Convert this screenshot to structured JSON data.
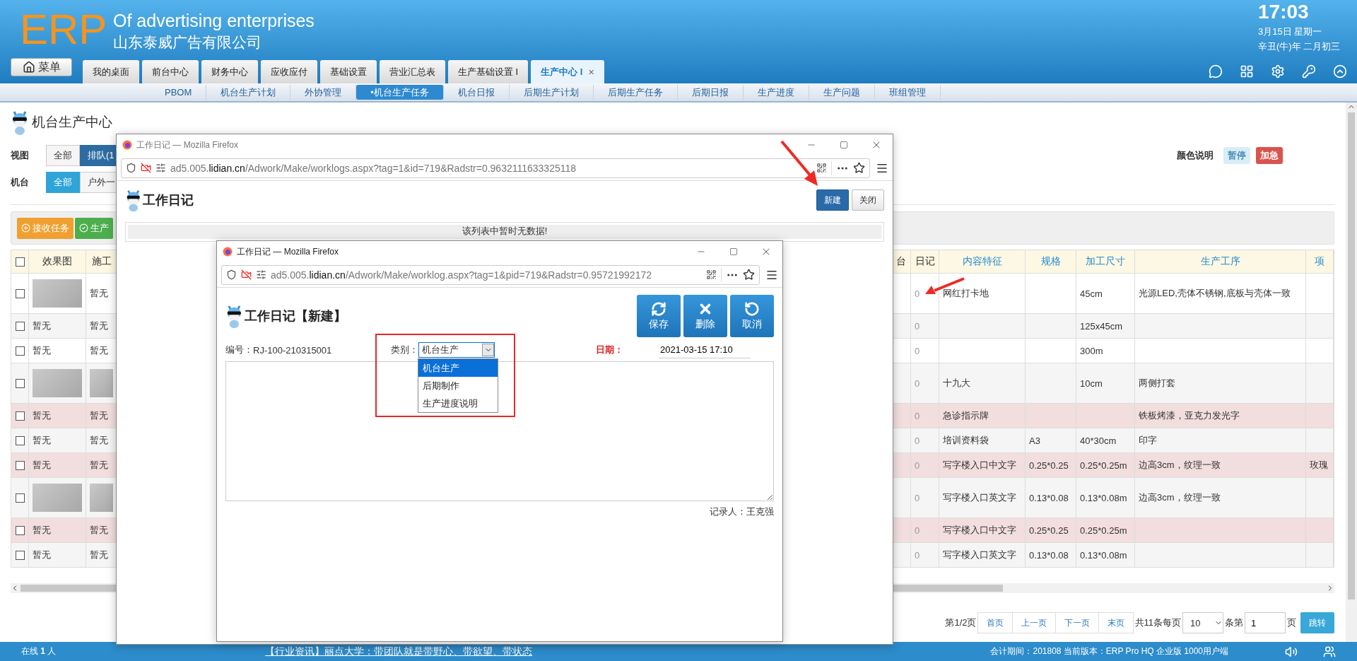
{
  "header": {
    "logo": "ERP",
    "title": "Of advertising enterprises",
    "company": "山东泰威广告有限公司",
    "time": "17:03",
    "date": "3月15日 星期一",
    "lunar": "辛丑(牛)年 二月初三",
    "menu_button": "菜单"
  },
  "tabs": [
    {
      "label": "我的桌面",
      "selected": false,
      "closable": false
    },
    {
      "label": "前台中心",
      "selected": false,
      "closable": false
    },
    {
      "label": "财务中心",
      "selected": false,
      "closable": false
    },
    {
      "label": "应收应付",
      "selected": false,
      "closable": false
    },
    {
      "label": "基础设置",
      "selected": false,
      "closable": false
    },
    {
      "label": "营业汇总表",
      "selected": false,
      "closable": false
    },
    {
      "label": "生产基础设置 I",
      "selected": false,
      "closable": false
    },
    {
      "label": "生产中心 I",
      "selected": true,
      "closable": true
    }
  ],
  "close_glyph": "×",
  "subnav": [
    {
      "label": "PBOM",
      "selected": false
    },
    {
      "label": "机台生产计划",
      "selected": false
    },
    {
      "label": "外协管理",
      "selected": false
    },
    {
      "label": "•机台生产任务",
      "selected": true
    },
    {
      "label": "机台日报",
      "selected": false
    },
    {
      "label": "后期生产计划",
      "selected": false
    },
    {
      "label": "后期生产任务",
      "selected": false
    },
    {
      "label": "后期日报",
      "selected": false
    },
    {
      "label": "生产进度",
      "selected": false
    },
    {
      "label": "生产问题",
      "selected": false
    },
    {
      "label": "班组管理",
      "selected": false
    }
  ],
  "page_title": "机台生产中心",
  "filters": [
    {
      "label": "视图",
      "kind": "primary",
      "options": [
        {
          "label": "全部",
          "selected": false
        },
        {
          "label": "排队(1",
          "selected": true
        }
      ]
    },
    {
      "label": "机台",
      "kind": "info",
      "options": [
        {
          "label": "全部",
          "selected": true
        },
        {
          "label": "户外一",
          "selected": false
        }
      ]
    }
  ],
  "color_legend": {
    "label": "颜色说明",
    "items": [
      {
        "label": "暂停",
        "color": "#d9edf7"
      },
      {
        "label": "加急",
        "color": "#d9534f"
      }
    ]
  },
  "actions": [
    {
      "label": "接收任务",
      "kind": "warning"
    },
    {
      "label": "生产",
      "kind": "success"
    }
  ],
  "table": {
    "all_checked": false,
    "columns": [
      {
        "label": "效果图",
        "sortable": false
      },
      {
        "label": "施工",
        "sortable": false
      },
      {
        "label": "台",
        "sortable": false
      },
      {
        "label": "日记",
        "sortable": false
      },
      {
        "label": "内容特征",
        "sortable": true
      },
      {
        "label": "规格",
        "sortable": true
      },
      {
        "label": "加工尺寸",
        "sortable": true
      },
      {
        "label": "生产工序",
        "sortable": true
      },
      {
        "label": "项",
        "sortable": true
      }
    ],
    "rows": [
      {
        "checked": false,
        "urgent": false,
        "cells": [
          {
            "kind": "image"
          },
          {
            "kind": "text",
            "text": "暂无"
          },
          null,
          {
            "kind": "count",
            "text": "0"
          },
          {
            "kind": "text",
            "text": "网红打卡地"
          },
          null,
          {
            "kind": "text",
            "text": "45cm"
          },
          {
            "kind": "text",
            "text": "光源LED,壳体不锈钢,底板与壳体一致"
          },
          null
        ]
      },
      {
        "checked": false,
        "urgent": false,
        "cells": [
          {
            "kind": "text",
            "text": "暂无"
          },
          {
            "kind": "text",
            "text": "暂无"
          },
          null,
          {
            "kind": "count",
            "text": "0"
          },
          null,
          null,
          {
            "kind": "text",
            "text": "125x45cm"
          },
          null,
          null
        ]
      },
      {
        "checked": false,
        "urgent": false,
        "cells": [
          {
            "kind": "text",
            "text": "暂无"
          },
          {
            "kind": "text",
            "text": "暂无"
          },
          null,
          {
            "kind": "count",
            "text": "0"
          },
          null,
          null,
          {
            "kind": "text",
            "text": "300m"
          },
          null,
          null
        ]
      },
      {
        "checked": false,
        "urgent": false,
        "cells": [
          {
            "kind": "image"
          },
          {
            "kind": "image"
          },
          null,
          {
            "kind": "count",
            "text": "0"
          },
          {
            "kind": "text",
            "text": "十九大"
          },
          null,
          {
            "kind": "text",
            "text": "10cm"
          },
          {
            "kind": "text",
            "text": "两侧打套"
          },
          null
        ]
      },
      {
        "checked": false,
        "urgent": true,
        "cells": [
          {
            "kind": "text",
            "text": "暂无"
          },
          {
            "kind": "text",
            "text": "暂无"
          },
          null,
          {
            "kind": "count",
            "text": "0"
          },
          {
            "kind": "text",
            "text": "急诊指示牌"
          },
          null,
          null,
          {
            "kind": "text",
            "text": "铁板烤漆，亚克力发光字"
          },
          null
        ]
      },
      {
        "checked": false,
        "urgent": false,
        "cells": [
          {
            "kind": "text",
            "text": "暂无"
          },
          {
            "kind": "text",
            "text": "暂无"
          },
          null,
          {
            "kind": "count",
            "text": "0"
          },
          {
            "kind": "text",
            "text": "培训资料袋"
          },
          {
            "kind": "text",
            "text": "A3"
          },
          {
            "kind": "text",
            "text": "40*30cm"
          },
          {
            "kind": "text",
            "text": "印字"
          },
          null
        ]
      },
      {
        "checked": false,
        "urgent": true,
        "cells": [
          {
            "kind": "text",
            "text": "暂无"
          },
          {
            "kind": "text",
            "text": "暂无"
          },
          null,
          {
            "kind": "count",
            "text": "0"
          },
          {
            "kind": "text",
            "text": "写字楼入口中文字"
          },
          {
            "kind": "text",
            "text": "0.25*0.25"
          },
          {
            "kind": "text",
            "text": "0.25*0.25m"
          },
          {
            "kind": "text",
            "text": "边高3cm，纹理一致"
          },
          {
            "kind": "text",
            "text": "玫瑰"
          }
        ]
      },
      {
        "checked": false,
        "urgent": false,
        "cells": [
          {
            "kind": "image"
          },
          {
            "kind": "image"
          },
          null,
          {
            "kind": "count",
            "text": "0"
          },
          {
            "kind": "text",
            "text": "写字楼入口英文字"
          },
          {
            "kind": "text",
            "text": "0.13*0.08"
          },
          {
            "kind": "text",
            "text": "0.13*0.08m"
          },
          {
            "kind": "text",
            "text": "边高3cm，纹理一致"
          },
          null
        ]
      },
      {
        "checked": false,
        "urgent": true,
        "cells": [
          {
            "kind": "text",
            "text": "暂无"
          },
          {
            "kind": "text",
            "text": "暂无"
          },
          null,
          {
            "kind": "count",
            "text": "0"
          },
          {
            "kind": "text",
            "text": "写字楼入口中文字"
          },
          {
            "kind": "text",
            "text": "0.25*0.25"
          },
          {
            "kind": "text",
            "text": "0.25*0.25m"
          },
          null,
          null
        ]
      },
      {
        "checked": false,
        "urgent": false,
        "cells": [
          {
            "kind": "text",
            "text": "暂无"
          },
          {
            "kind": "text",
            "text": "暂无"
          },
          null,
          {
            "kind": "count",
            "text": "0"
          },
          {
            "kind": "text",
            "text": "写字楼入口英文字"
          },
          {
            "kind": "text",
            "text": "0.13*0.08"
          },
          {
            "kind": "text",
            "text": "0.13*0.08m"
          },
          null,
          null
        ]
      }
    ]
  },
  "pagination": {
    "page_info": "第1/2页",
    "nav": [
      "首页",
      "上一页",
      "下一页",
      "末页"
    ],
    "total_text": "共11条每页",
    "page_size": "10",
    "goto_prefix": "条第",
    "page": "1",
    "goto_suffix": "页",
    "goto_button": "跳转"
  },
  "status_bar": {
    "online": "在线 **1** 人",
    "news": "【行业资讯】丽点大学：带团队就是带野心、带欲望、带状态",
    "info": "会计期间：201808 当前版本：ERP Pro HQ 企业版 1000用户端"
  },
  "outer_window": {
    "title": "工作日记 — Mozilla Firefox",
    "url": {
      "host_prefix": "ad5.005.",
      "domain": "lidian.cn",
      "path": "/Adwork/Make/worklogs.aspx?tag=1&id=719&Radstr=0.9632111633325118"
    },
    "heading": "工作日记",
    "buttons": [
      {
        "label": "新建",
        "kind": "primary"
      },
      {
        "label": "关闭",
        "kind": "default"
      }
    ],
    "empty_message": "该列表中暂时无数据!"
  },
  "inner_window": {
    "title": "工作日记 — Mozilla Firefox",
    "url": {
      "host_prefix": "ad5.005.",
      "domain": "lidian.cn",
      "path": "/Adwork/Make/worklog.aspx?tag=1&pid=719&Radstr=0.95721992172"
    },
    "heading": "工作日记【新建】",
    "buttons": [
      {
        "label": "保存",
        "kind": "save"
      },
      {
        "label": "删除",
        "kind": "delete"
      },
      {
        "label": "取消",
        "kind": "cancel"
      }
    ],
    "number": {
      "label": "编号：",
      "value": "RJ-100-210315001"
    },
    "category": {
      "label": "类别：",
      "value": "机台生产",
      "expanded": true,
      "options": [
        {
          "label": "机台生产",
          "selected": true
        },
        {
          "label": "后期制作",
          "selected": false
        },
        {
          "label": "生产进度说明",
          "selected": false
        }
      ]
    },
    "date": {
      "label": "日期：",
      "required": true,
      "value": "2021-03-15 17:10"
    },
    "recorder": "记录人：王克强"
  }
}
